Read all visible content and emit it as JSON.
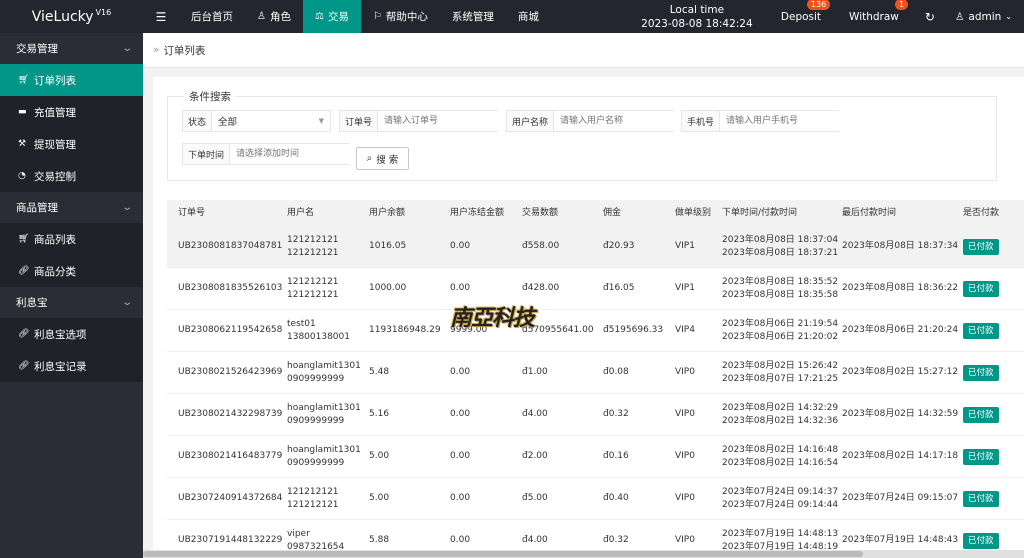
{
  "app": {
    "title": "VieLucky",
    "version": "V16"
  },
  "topnav": {
    "toggle_icon": "menu-toggle-icon",
    "items": [
      {
        "label": "后台首页",
        "icon": ""
      },
      {
        "label": "角色",
        "icon": "user-icon"
      },
      {
        "label": "交易",
        "icon": "scale-icon",
        "active": true
      },
      {
        "label": "帮助中心",
        "icon": "flag-icon"
      },
      {
        "label": "系统管理",
        "icon": ""
      },
      {
        "label": "商城",
        "icon": ""
      }
    ],
    "localtime_label": "Local time",
    "localtime_value": "2023-08-08 18:42:24",
    "deposit_label": "Deposit",
    "deposit_badge": "136",
    "withdraw_label": "Withdraw",
    "withdraw_badge": "1",
    "user": "admin"
  },
  "sidebar": {
    "groups": [
      {
        "label": "交易管理",
        "items": [
          {
            "label": "订单列表",
            "icon": "cart-icon",
            "active": true
          },
          {
            "label": "充值管理",
            "icon": "card-icon"
          },
          {
            "label": "提现管理",
            "icon": "gavel-icon"
          },
          {
            "label": "交易控制",
            "icon": "dashboard-icon"
          }
        ]
      },
      {
        "label": "商品管理",
        "items": [
          {
            "label": "商品列表",
            "icon": "cart-icon"
          },
          {
            "label": "商品分类",
            "icon": "link-icon"
          }
        ]
      },
      {
        "label": "利息宝",
        "items": [
          {
            "label": "利息宝选项",
            "icon": "link-icon"
          },
          {
            "label": "利息宝记录",
            "icon": "link-icon"
          }
        ]
      }
    ]
  },
  "breadcrumb": "订单列表",
  "search": {
    "legend": "条件搜索",
    "status_label": "状态",
    "status_value": "全部",
    "order_label": "订单号",
    "order_placeholder": "请输入订单号",
    "username_label": "用户名称",
    "username_placeholder": "请输入用户名称",
    "phone_label": "手机号",
    "phone_placeholder": "请输入用户手机号",
    "time_label": "下单时间",
    "time_placeholder": "请选择添加时间",
    "button_label": "搜 索"
  },
  "table": {
    "headers": [
      "订单号",
      "用户名",
      "用户余额",
      "用户冻结金额",
      "交易数额",
      "佣金",
      "做单级别",
      "下单时间/付款时间",
      "最后付款时间",
      "是否付款"
    ],
    "rows": [
      {
        "order": "UB2308081837048781",
        "user1": "121212121",
        "user2": "121212121",
        "balance": "1016.05",
        "frozen": "0.00",
        "amount": "đ558.00",
        "commission": "đ20.93",
        "level": "VIP1",
        "t1": "2023年08月08日 18:37:04",
        "t2": "2023年08月08日 18:37:21",
        "last": "2023年08月08日 18:37:34",
        "paid": "已付款"
      },
      {
        "order": "UB2308081835526103",
        "user1": "121212121",
        "user2": "121212121",
        "balance": "1000.00",
        "frozen": "0.00",
        "amount": "đ428.00",
        "commission": "đ16.05",
        "level": "VIP1",
        "t1": "2023年08月08日 18:35:52",
        "t2": "2023年08月08日 18:35:58",
        "last": "2023年08月08日 18:36:22",
        "paid": "已付款"
      },
      {
        "order": "UB2308062119542658",
        "user1": "test01",
        "user2": "13800138001",
        "balance": "1193186948.29",
        "frozen": "9999.00",
        "amount": "đ570955641.00",
        "commission": "đ5195696.33",
        "level": "VIP4",
        "t1": "2023年08月06日 21:19:54",
        "t2": "2023年08月06日 21:20:02",
        "last": "2023年08月06日 21:20:24",
        "paid": "已付款"
      },
      {
        "order": "UB2308021526423969",
        "user1": "hoanglamit1301",
        "user2": "0909999999",
        "balance": "5.48",
        "frozen": "0.00",
        "amount": "đ1.00",
        "commission": "đ0.08",
        "level": "VIP0",
        "t1": "2023年08月02日 15:26:42",
        "t2": "2023年08月07日 17:21:25",
        "last": "2023年08月02日 15:27:12",
        "paid": "已付款"
      },
      {
        "order": "UB2308021432298739",
        "user1": "hoanglamit1301",
        "user2": "0909999999",
        "balance": "5.16",
        "frozen": "0.00",
        "amount": "đ4.00",
        "commission": "đ0.32",
        "level": "VIP0",
        "t1": "2023年08月02日 14:32:29",
        "t2": "2023年08月02日 14:32:36",
        "last": "2023年08月02日 14:32:59",
        "paid": "已付款"
      },
      {
        "order": "UB2308021416483779",
        "user1": "hoanglamit1301",
        "user2": "0909999999",
        "balance": "5.00",
        "frozen": "0.00",
        "amount": "đ2.00",
        "commission": "đ0.16",
        "level": "VIP0",
        "t1": "2023年08月02日 14:16:48",
        "t2": "2023年08月02日 14:16:54",
        "last": "2023年08月02日 14:17:18",
        "paid": "已付款"
      },
      {
        "order": "UB2307240914372684",
        "user1": "121212121",
        "user2": "121212121",
        "balance": "5.00",
        "frozen": "0.00",
        "amount": "đ5.00",
        "commission": "đ0.40",
        "level": "VIP0",
        "t1": "2023年07月24日 09:14:37",
        "t2": "2023年07月24日 09:14:44",
        "last": "2023年07月24日 09:15:07",
        "paid": "已付款"
      },
      {
        "order": "UB2307191448132229",
        "user1": "viper",
        "user2": "0987321654",
        "balance": "5.88",
        "frozen": "0.00",
        "amount": "đ4.00",
        "commission": "đ0.32",
        "level": "VIP0",
        "t1": "2023年07月19日 14:48:13",
        "t2": "2023年07月19日 14:48:19",
        "last": "2023年07月19日 14:48:43",
        "paid": "已付款"
      }
    ]
  },
  "watermark": "南亞科技"
}
